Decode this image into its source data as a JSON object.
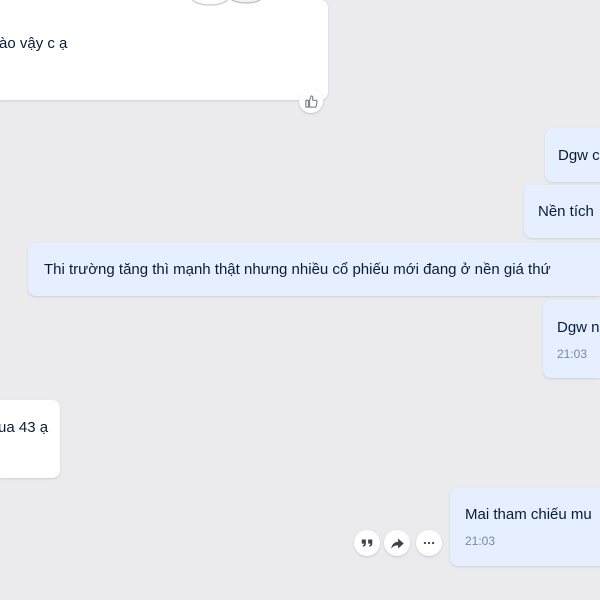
{
  "colors": {
    "background": "#ebebed",
    "sent_bubble": "#e5efff",
    "received_bubble": "#ffffff",
    "text": "#081c36",
    "time": "#7589a3"
  },
  "messages": [
    {
      "direction": "received",
      "text": "ào vậy c ạ",
      "reaction_icon": "thumbs-up-icon"
    },
    {
      "direction": "sent",
      "text": "Dgw c"
    },
    {
      "direction": "sent",
      "text": "Nền tích"
    },
    {
      "direction": "sent",
      "text": "Thi trường tăng thì mạnh thật nhưng nhiều cổ phiếu mới đang ở nền giá thứ"
    },
    {
      "direction": "sent",
      "text": "Dgw n",
      "time": "21:03"
    },
    {
      "direction": "received",
      "text": "ua 43 ạ"
    },
    {
      "direction": "sent",
      "text": "Mai tham chiếu mu",
      "time": "21:03",
      "actions": [
        "quote-icon",
        "forward-icon",
        "more-icon"
      ]
    }
  ]
}
